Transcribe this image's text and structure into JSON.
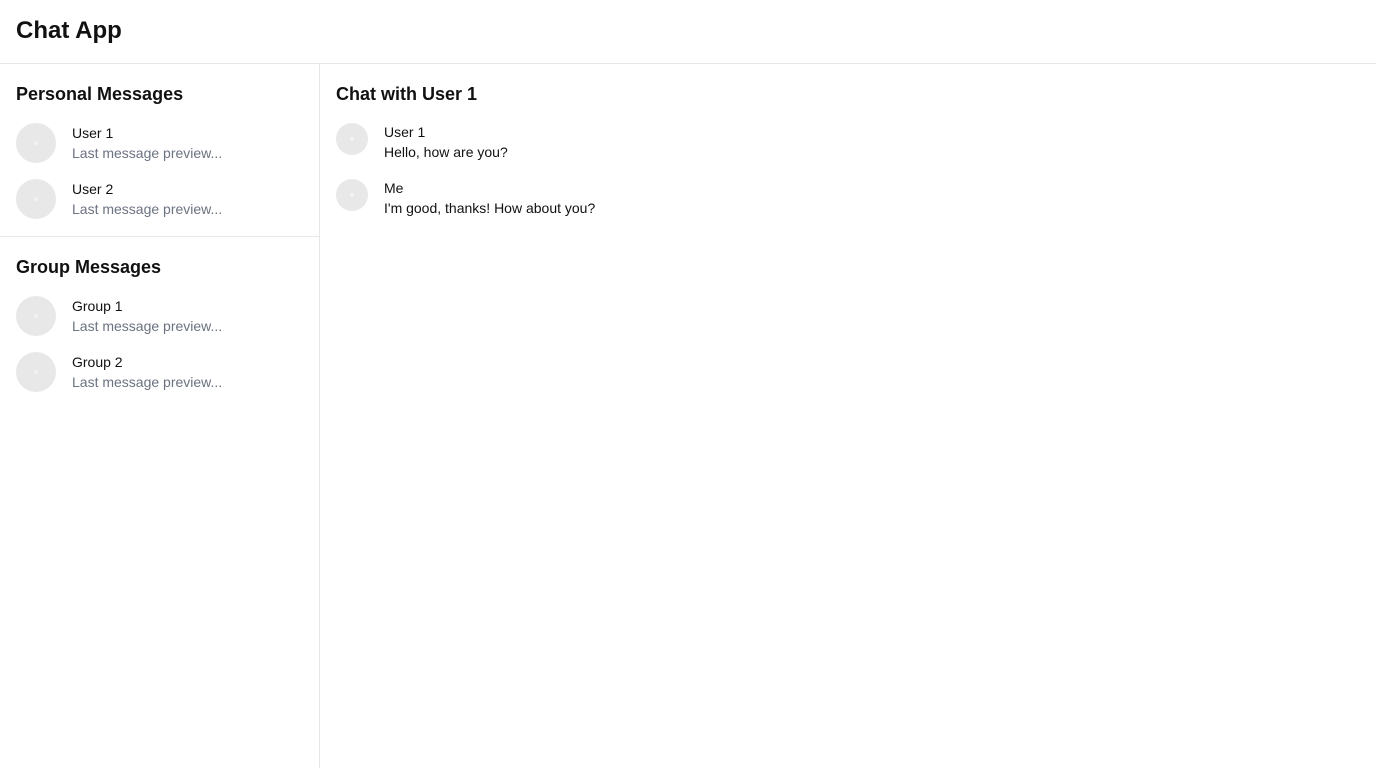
{
  "app": {
    "title": "Chat App"
  },
  "sidebar": {
    "personal": {
      "title": "Personal Messages",
      "items": [
        {
          "name": "User 1",
          "preview": "Last message preview..."
        },
        {
          "name": "User 2",
          "preview": "Last message preview..."
        }
      ]
    },
    "groups": {
      "title": "Group Messages",
      "items": [
        {
          "name": "Group 1",
          "preview": "Last message preview..."
        },
        {
          "name": "Group 2",
          "preview": "Last message preview..."
        }
      ]
    }
  },
  "chat": {
    "title": "Chat with User 1",
    "messages": [
      {
        "sender": "User 1",
        "text": "Hello, how are you?"
      },
      {
        "sender": "Me",
        "text": "I'm good, thanks! How about you?"
      }
    ]
  }
}
